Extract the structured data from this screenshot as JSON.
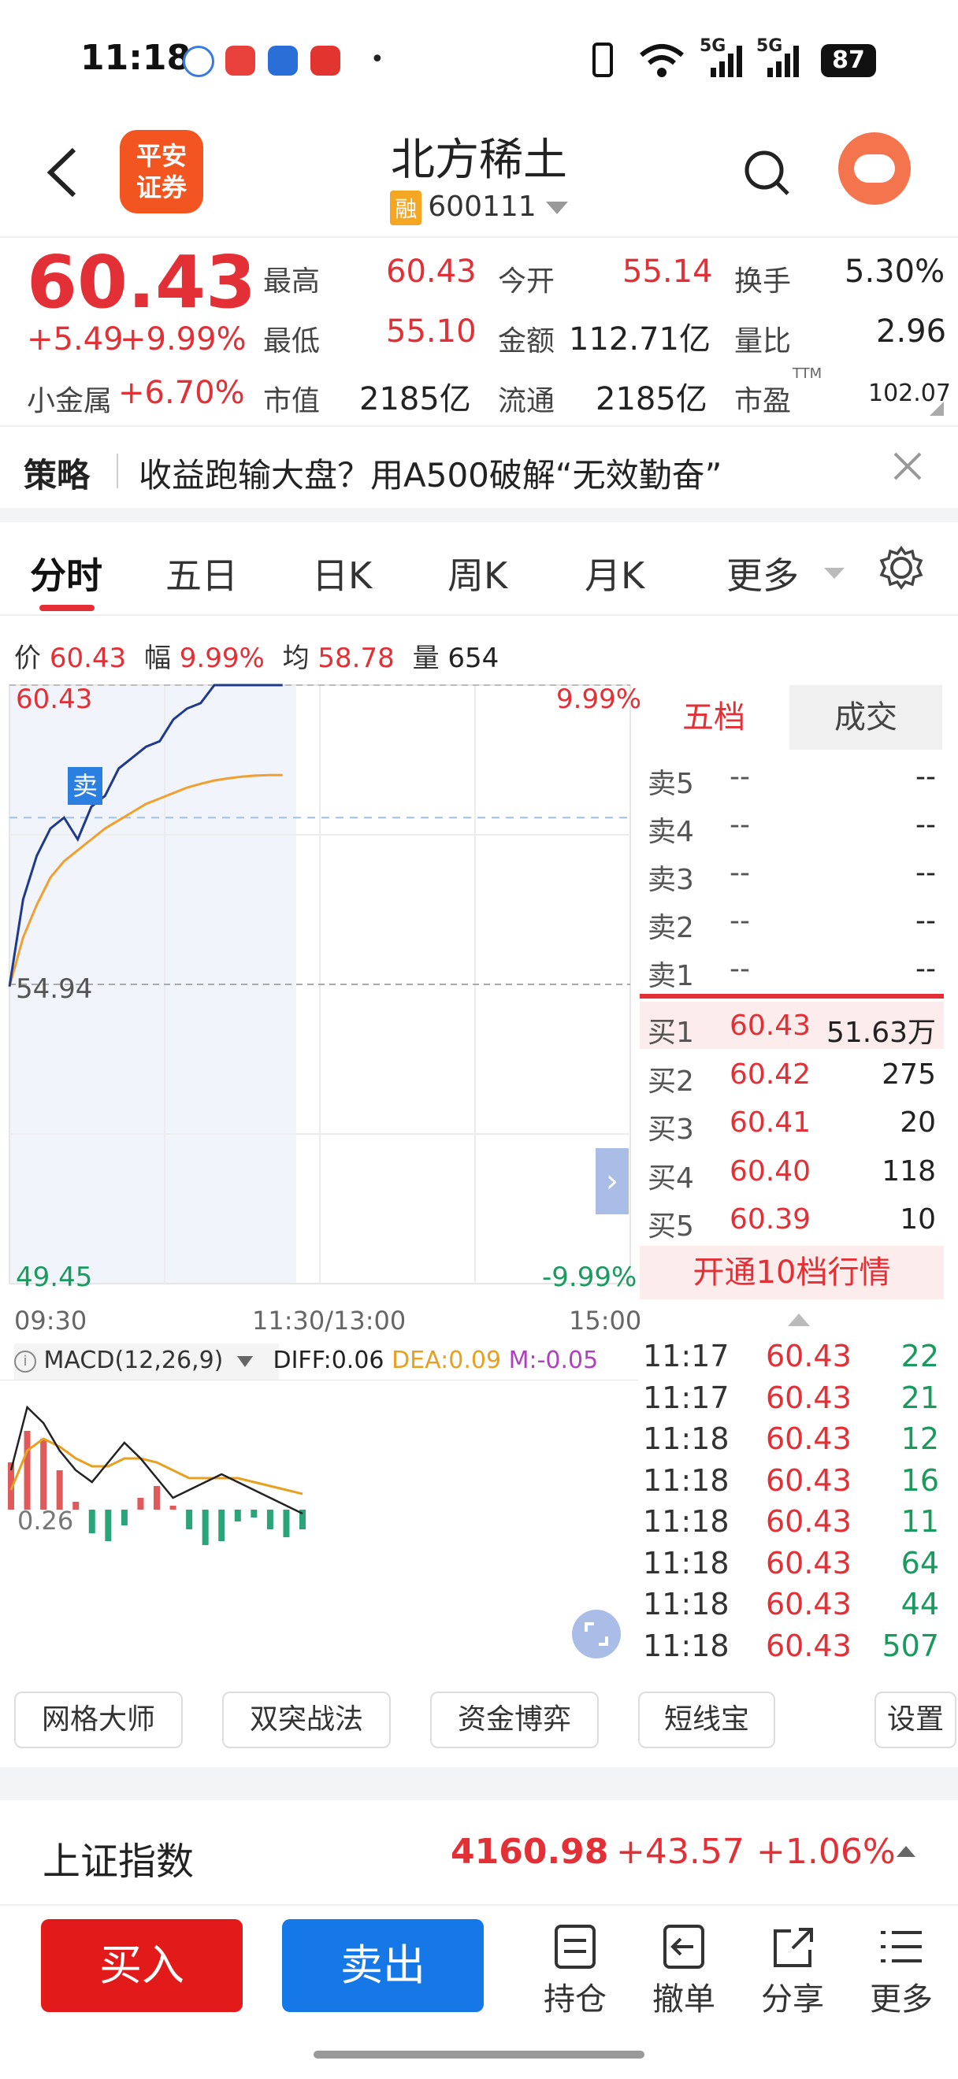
{
  "status_bar": {
    "time": "11:18",
    "dot": "•",
    "net1": "5G",
    "net2": "5G",
    "battery": "87"
  },
  "header": {
    "logo_line1": "平安",
    "logo_line2": "证券",
    "title": "北方稀土",
    "badge": "融",
    "code": "600111"
  },
  "quote": {
    "price": "60.43",
    "change": "+5.49",
    "change_pct": "+9.99%",
    "sector_label": "小金属",
    "sector_pct": "+6.70%",
    "high_label": "最高",
    "high": "60.43",
    "low_label": "最低",
    "low": "55.10",
    "mktcap_label": "市值",
    "mktcap": "2185亿",
    "open_label": "今开",
    "open": "55.14",
    "amount_label": "金额",
    "amount": "112.71亿",
    "float_label": "流通",
    "float": "2185亿",
    "turnover_label": "换手",
    "turnover": "5.30%",
    "vol_ratio_label": "量比",
    "vol_ratio": "2.96",
    "pe_label": "市盈",
    "pe_sup": "TTM",
    "pe": "102.07"
  },
  "banner": {
    "tag": "策略",
    "text": "收益跑输大盘？用A500破解“无效勤奋”"
  },
  "tabs": [
    "分时",
    "五日",
    "日K",
    "周K",
    "月K",
    "更多"
  ],
  "info_line": {
    "price_label": "价",
    "price": "60.43",
    "amp_label": "幅",
    "amp": "9.99%",
    "avg_label": "均",
    "avg": "58.78",
    "vol_label": "量",
    "vol": "654"
  },
  "chart_data": {
    "type": "line",
    "title": "",
    "y_top_label": "60.43",
    "y_mid_label": "54.94",
    "y_bottom_label": "49.45",
    "pct_top": "9.99%",
    "pct_bottom": "-9.99%",
    "ylim": [
      49.45,
      60.43
    ],
    "x_labels": [
      "09:30",
      "11:30/13:00",
      "15:00"
    ],
    "series": [
      {
        "name": "价",
        "color": "#1f3a8a",
        "values": [
          54.9,
          56.5,
          57.3,
          57.8,
          58.0,
          57.6,
          58.2,
          58.4,
          58.9,
          59.1,
          59.3,
          59.4,
          59.8,
          60.0,
          60.1,
          60.43,
          60.43,
          60.43,
          60.43,
          60.43,
          60.43
        ]
      },
      {
        "name": "均",
        "color": "#f0a030",
        "values": [
          54.9,
          55.8,
          56.4,
          56.9,
          57.2,
          57.4,
          57.6,
          57.8,
          57.95,
          58.1,
          58.25,
          58.35,
          58.45,
          58.55,
          58.62,
          58.68,
          58.72,
          58.75,
          58.77,
          58.78,
          58.78
        ]
      }
    ],
    "sell_marker": "卖",
    "macd": {
      "label": "MACD(12,26,9)",
      "diff": "DIFF:0.06",
      "dea": "DEA:0.09",
      "m": "M:-0.05",
      "level": "0.26",
      "diff_values": [
        0.1,
        0.26,
        0.22,
        0.15,
        0.1,
        0.07,
        0.12,
        0.17,
        0.13,
        0.08,
        0.03,
        0.05,
        0.07,
        0.09,
        0.07,
        0.05,
        0.03,
        0.01,
        -0.01
      ],
      "dea_values": [
        0.05,
        0.15,
        0.18,
        0.16,
        0.13,
        0.11,
        0.11,
        0.13,
        0.13,
        0.12,
        0.1,
        0.08,
        0.08,
        0.08,
        0.08,
        0.07,
        0.06,
        0.05,
        0.04
      ],
      "m_values": [
        0.12,
        0.2,
        0.18,
        0.1,
        0.02,
        -0.06,
        -0.08,
        -0.04,
        0.03,
        0.06,
        0.01,
        -0.05,
        -0.09,
        -0.08,
        -0.03,
        -0.02,
        -0.05,
        -0.07,
        -0.05
      ]
    }
  },
  "orderbook": {
    "tab1": "五档",
    "tab2": "成交",
    "sells": [
      {
        "label": "卖5",
        "price": "--",
        "vol": "--"
      },
      {
        "label": "卖4",
        "price": "--",
        "vol": "--"
      },
      {
        "label": "卖3",
        "price": "--",
        "vol": "--"
      },
      {
        "label": "卖2",
        "price": "--",
        "vol": "--"
      },
      {
        "label": "卖1",
        "price": "--",
        "vol": "--"
      }
    ],
    "buys": [
      {
        "label": "买1",
        "price": "60.43",
        "vol": "51.63万"
      },
      {
        "label": "买2",
        "price": "60.42",
        "vol": "275"
      },
      {
        "label": "买3",
        "price": "60.41",
        "vol": "20"
      },
      {
        "label": "买4",
        "price": "60.40",
        "vol": "118"
      },
      {
        "label": "买5",
        "price": "60.39",
        "vol": "10"
      }
    ],
    "upgrade": "开通10档行情"
  },
  "trades": [
    {
      "time": "11:17",
      "price": "60.43",
      "vol": "22"
    },
    {
      "time": "11:17",
      "price": "60.43",
      "vol": "21"
    },
    {
      "time": "11:18",
      "price": "60.43",
      "vol": "12"
    },
    {
      "time": "11:18",
      "price": "60.43",
      "vol": "16"
    },
    {
      "time": "11:18",
      "price": "60.43",
      "vol": "11"
    },
    {
      "time": "11:18",
      "price": "60.43",
      "vol": "64"
    },
    {
      "time": "11:18",
      "price": "60.43",
      "vol": "44"
    },
    {
      "time": "11:18",
      "price": "60.43",
      "vol": "507"
    }
  ],
  "tools": [
    "网格大师",
    "双突战法",
    "资金博弈",
    "短线宝",
    "设置"
  ],
  "index": {
    "name": "上证指数",
    "value": "4160.98",
    "change": "+43.57",
    "pct": "+1.06%"
  },
  "bottom": {
    "buy": "买入",
    "sell": "卖出",
    "hold": "持仓",
    "cancel": "撤单",
    "share": "分享",
    "more": "更多"
  }
}
